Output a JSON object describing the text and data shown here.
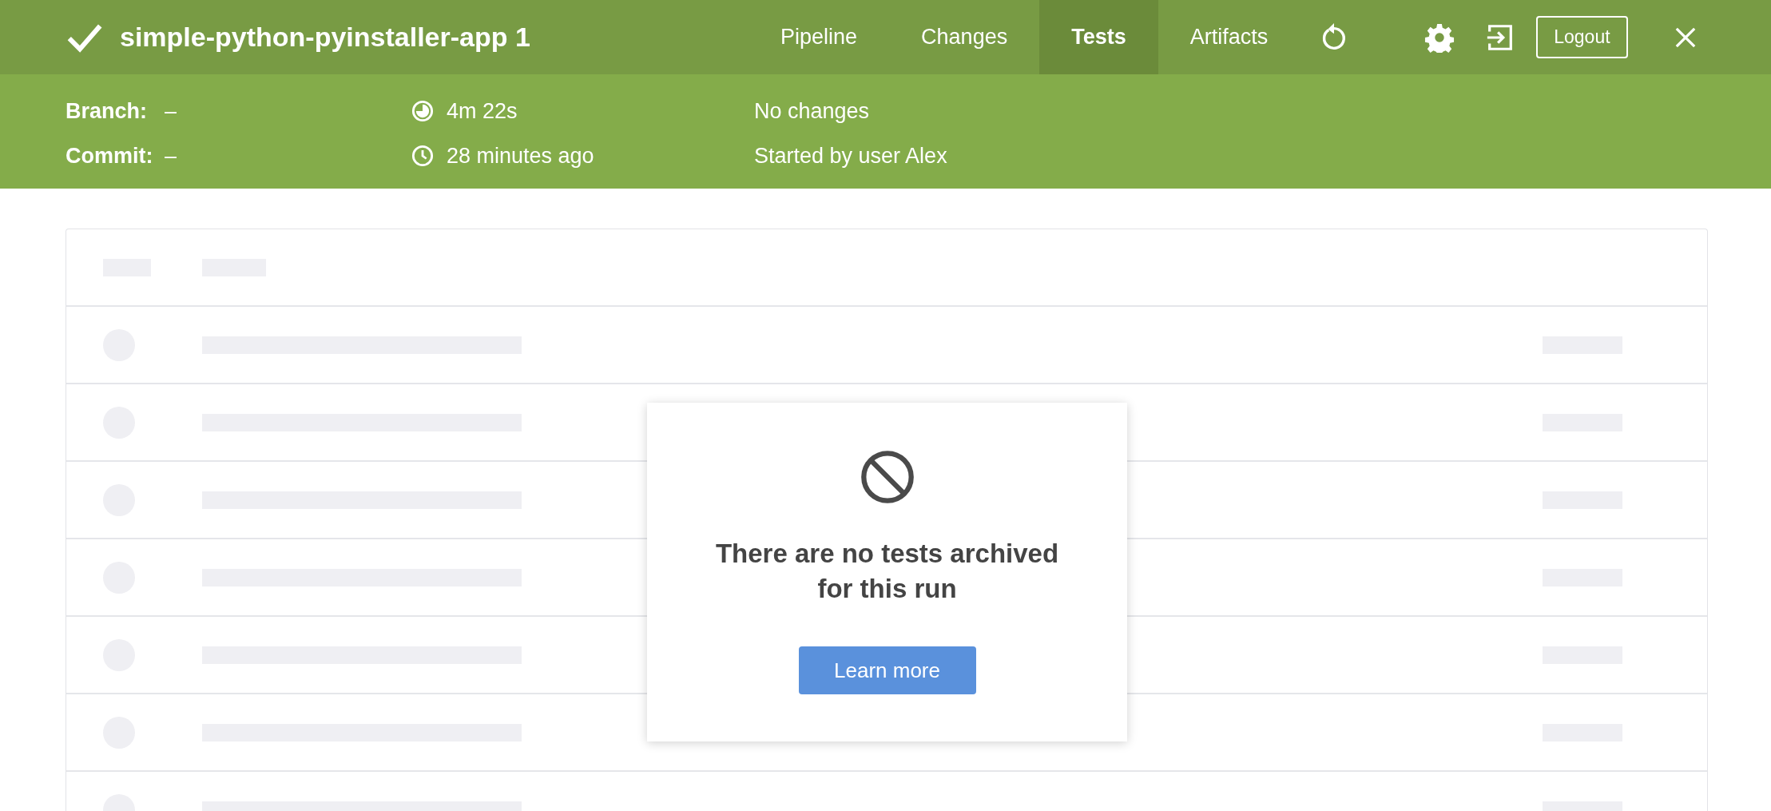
{
  "header": {
    "kind": "success",
    "title": "simple-python-pyinstaller-app 1",
    "tabs": [
      {
        "label": "Pipeline",
        "selected": false
      },
      {
        "label": "Changes",
        "selected": false
      },
      {
        "label": "Tests",
        "selected": true
      },
      {
        "label": "Artifacts",
        "selected": false
      }
    ],
    "logout": "Logout"
  },
  "summary": {
    "branch_label": "Branch:",
    "branch": "–",
    "commit_label": "Commit:",
    "commit": "–",
    "duration": "4m 22s",
    "time": "28 minutes ago",
    "changes": "No changes",
    "cause": "Started by user Alex"
  },
  "empty_state": {
    "message": "There are no tests archived for this run",
    "button": "Learn more"
  }
}
